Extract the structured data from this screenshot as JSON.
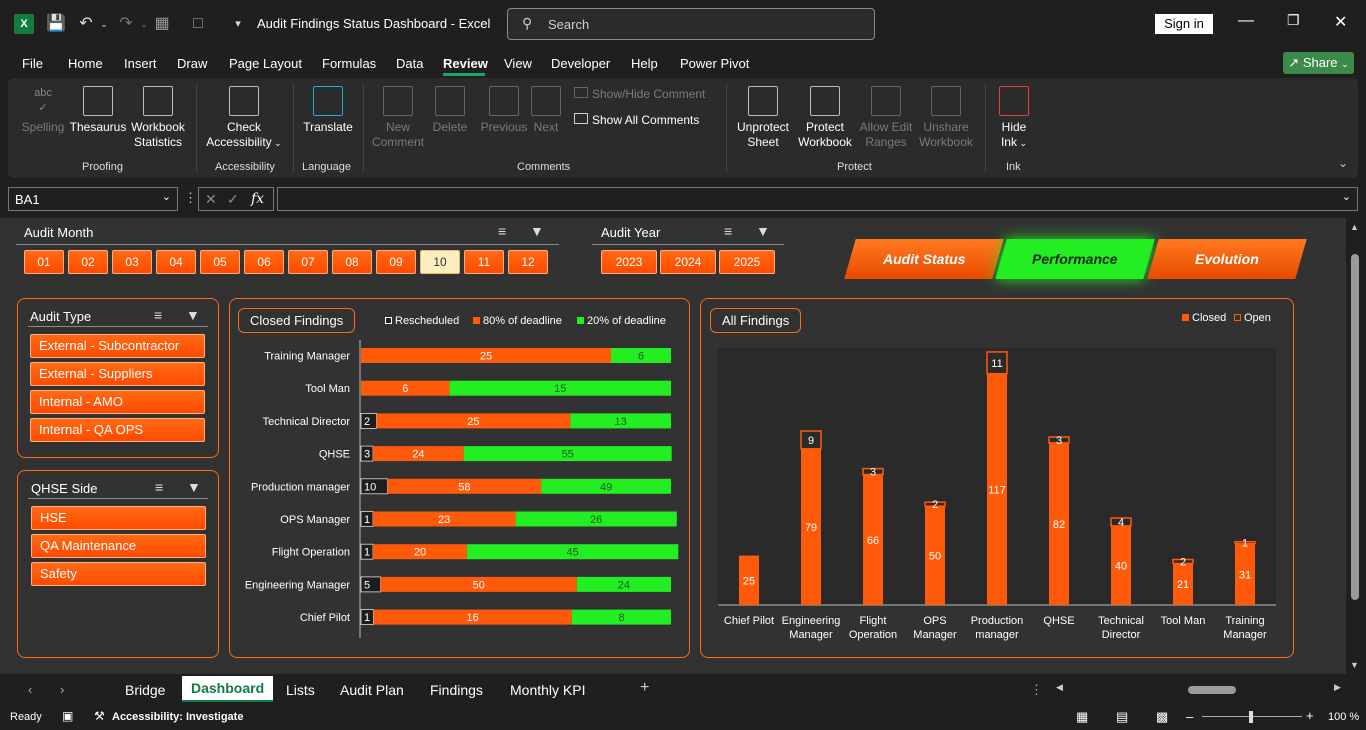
{
  "window": {
    "doc_title": "Audit Findings Status Dashboard  -  Excel",
    "search_placeholder": "Search",
    "sign_in": "Sign in",
    "share": "Share"
  },
  "menu": [
    "File",
    "Home",
    "Insert",
    "Draw",
    "Page Layout",
    "Formulas",
    "Data",
    "Review",
    "View",
    "Developer",
    "Help",
    "Power Pivot"
  ],
  "menu_active": "Review",
  "ribbon": {
    "spelling": "Spelling",
    "thesaurus": "Thesaurus",
    "workbook_statistics_1": "Workbook",
    "workbook_statistics_2": "Statistics",
    "check_accessibility_1": "Check",
    "check_accessibility_2": "Accessibility",
    "translate": "Translate",
    "new_comment_1": "New",
    "new_comment_2": "Comment",
    "delete": "Delete",
    "previous": "Previous",
    "next": "Next",
    "show_hide_comment": "Show/Hide Comment",
    "show_all_comments": "Show All Comments",
    "unprotect_sheet_1": "Unprotect",
    "unprotect_sheet_2": "Sheet",
    "protect_workbook_1": "Protect",
    "protect_workbook_2": "Workbook",
    "allow_edit_ranges_1": "Allow Edit",
    "allow_edit_ranges_2": "Ranges",
    "unshare_workbook_1": "Unshare",
    "unshare_workbook_2": "Workbook",
    "hide_ink_1": "Hide",
    "hide_ink_2": "Ink",
    "groups": {
      "proofing": "Proofing",
      "accessibility": "Accessibility",
      "language": "Language",
      "comments": "Comments",
      "protect": "Protect",
      "ink": "Ink"
    }
  },
  "formula_bar": {
    "name_box": "BA1",
    "fx": "fx",
    "formula": ""
  },
  "slicers": {
    "audit_month": {
      "title": "Audit Month",
      "items": [
        "01",
        "02",
        "03",
        "04",
        "05",
        "06",
        "07",
        "08",
        "09",
        "10",
        "11",
        "12"
      ],
      "selected": "10"
    },
    "audit_year": {
      "title": "Audit Year",
      "items": [
        "2023",
        "2024",
        "2025"
      ]
    },
    "audit_type": {
      "title": "Audit Type",
      "items": [
        "External - Subcontractor",
        "External - Suppliers",
        "Internal - AMO",
        "Internal - QA OPS"
      ]
    },
    "qhse_side": {
      "title": "QHSE Side",
      "items": [
        "HSE",
        "QA Maintenance",
        "Safety"
      ]
    }
  },
  "nav_buttons": {
    "audit_status": "Audit Status",
    "performance": "Performance",
    "evolution": "Evolution"
  },
  "colors": {
    "orange": "#ff5a0a",
    "green": "#22ee22",
    "dark_bg": "#323232"
  },
  "closed_findings": {
    "title": "Closed Findings",
    "legend": [
      "Rescheduled",
      "80% of deadline",
      "20% of deadline"
    ]
  },
  "all_findings": {
    "title": "All Findings",
    "legend": [
      "Closed",
      "Open"
    ]
  },
  "chart_data": [
    {
      "type": "bar",
      "orientation": "horizontal",
      "stacked": true,
      "title": "Closed Findings",
      "categories": [
        "Training Manager",
        "Tool Man",
        "Technical Director",
        "QHSE",
        "Production manager",
        "OPS Manager",
        "Flight Operation",
        "Engineering Manager",
        "Chief Pilot"
      ],
      "series": [
        {
          "name": "Rescheduled",
          "values": [
            0,
            0,
            2,
            3,
            10,
            1,
            1,
            5,
            1
          ]
        },
        {
          "name": "80% of deadline",
          "values": [
            25,
            6,
            25,
            24,
            58,
            23,
            20,
            50,
            16
          ]
        },
        {
          "name": "20% of deadline",
          "values": [
            6,
            15,
            13,
            55,
            49,
            26,
            45,
            24,
            8
          ]
        }
      ],
      "legend": "top"
    },
    {
      "type": "bar",
      "stacked": true,
      "title": "All Findings",
      "categories": [
        "Chief Pilot",
        "Engineering Manager",
        "Flight Operation",
        "OPS Manager",
        "Production manager",
        "QHSE",
        "Technical Director",
        "Tool Man",
        "Training Manager"
      ],
      "series": [
        {
          "name": "Closed",
          "values": [
            25,
            79,
            66,
            50,
            117,
            82,
            40,
            21,
            31
          ]
        },
        {
          "name": "Open",
          "values": [
            0,
            9,
            3,
            2,
            11,
            3,
            4,
            2,
            1
          ]
        }
      ],
      "legend": "top-right"
    }
  ],
  "sheet_tabs": [
    "Bridge",
    "Dashboard",
    "Lists",
    "Audit Plan",
    "Findings",
    "Monthly KPI"
  ],
  "active_tab": "Dashboard",
  "status_bar": {
    "ready": "Ready",
    "accessibility": "Accessibility: Investigate",
    "zoom": "100 %"
  }
}
